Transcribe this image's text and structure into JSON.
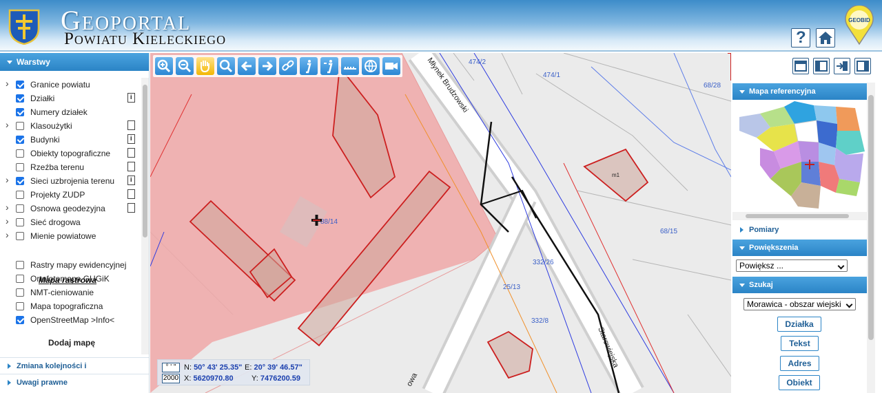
{
  "header": {
    "title_main": "Geoportal",
    "title_sub": "Powiatu Kieleckiego",
    "help_label": "?",
    "logo_text": "GEOBID"
  },
  "left_panel": {
    "title": "Warstwy",
    "layers": [
      {
        "label": "Granice powiatu",
        "checked": true,
        "expandable": true,
        "doc": ""
      },
      {
        "label": "Działki",
        "checked": true,
        "expandable": false,
        "doc": "info"
      },
      {
        "label": "Numery działek",
        "checked": true,
        "expandable": false,
        "doc": ""
      },
      {
        "label": "Klasoużytki",
        "checked": false,
        "expandable": true,
        "doc": "plain"
      },
      {
        "label": "Budynki",
        "checked": true,
        "expandable": false,
        "doc": "info"
      },
      {
        "label": "Obiekty topograficzne",
        "checked": false,
        "expandable": false,
        "doc": "plain"
      },
      {
        "label": "Rzeźba terenu",
        "checked": false,
        "expandable": false,
        "doc": "plain"
      },
      {
        "label": "Sieci uzbrojenia terenu",
        "checked": true,
        "expandable": true,
        "doc": "info"
      },
      {
        "label": "Projekty ZUDP",
        "checked": false,
        "expandable": false,
        "doc": "plain"
      },
      {
        "label": "Osnowa geodezyjna",
        "checked": false,
        "expandable": true,
        "doc": "plain"
      },
      {
        "label": "Sieć drogowa",
        "checked": false,
        "expandable": true,
        "doc": ""
      },
      {
        "label": "Mienie powiatowe",
        "checked": false,
        "expandable": true,
        "doc": ""
      }
    ],
    "raster_title": "Mapa rastrowa",
    "raster_layers": [
      {
        "label": "Rastry mapy ewidencyjnej",
        "checked": false
      },
      {
        "label": "Ortofotomapa GUGiK",
        "checked": false
      },
      {
        "label": "NMT-cieniowanie",
        "checked": false
      },
      {
        "label": "Mapa topograficzna",
        "checked": false
      },
      {
        "label": "OpenStreetMap >Info<",
        "checked": true
      }
    ],
    "add_map": "Dodaj mapę",
    "cut_text": "Generalna Dyrekcja Ochrony",
    "accordions": [
      "Zmiana kolejności i przezroczystości",
      "Uwagi prawne"
    ]
  },
  "map": {
    "toolbar": [
      {
        "name": "zoom-in-tool"
      },
      {
        "name": "zoom-out-tool"
      },
      {
        "name": "pan-tool",
        "active": true
      },
      {
        "name": "zoom-box-tool"
      },
      {
        "name": "previous-view-tool"
      },
      {
        "name": "next-view-tool"
      },
      {
        "name": "link-tool"
      },
      {
        "name": "info-tool"
      },
      {
        "name": "info-advanced-tool"
      },
      {
        "name": "measure-tool"
      },
      {
        "name": "globe-tool"
      },
      {
        "name": "camera-tool"
      }
    ],
    "labels": {
      "street1": "Młynek Brudzowski",
      "street2": "Starowiejska",
      "street3": "owa",
      "parcels": [
        "474/2",
        "474/1",
        "68/28",
        "88/14",
        "68/15",
        "332/26",
        "332/8",
        "25/13"
      ],
      "bld_code": "m1"
    },
    "coords": {
      "deg_label": "° ' \"",
      "sys_label": "2000",
      "n_label": "N:",
      "n_value": "50° 43' 25.35\"",
      "e_label": "E:",
      "e_value": "20° 39' 46.57\"",
      "x_label": "X:",
      "x_value": "5620970.80",
      "y_label": "Y:",
      "y_value": "7476200.59"
    }
  },
  "right_panel": {
    "ref_title": "Mapa referencyjna",
    "measure": "Pomiary",
    "zoom_title": "Powiększenia",
    "zoom_select": "Powiększ ...",
    "search_title": "Szukaj",
    "search_select": "Morawica - obszar wiejski",
    "buttons": [
      "Działka",
      "Tekst",
      "Adres",
      "Obiekt"
    ]
  }
}
